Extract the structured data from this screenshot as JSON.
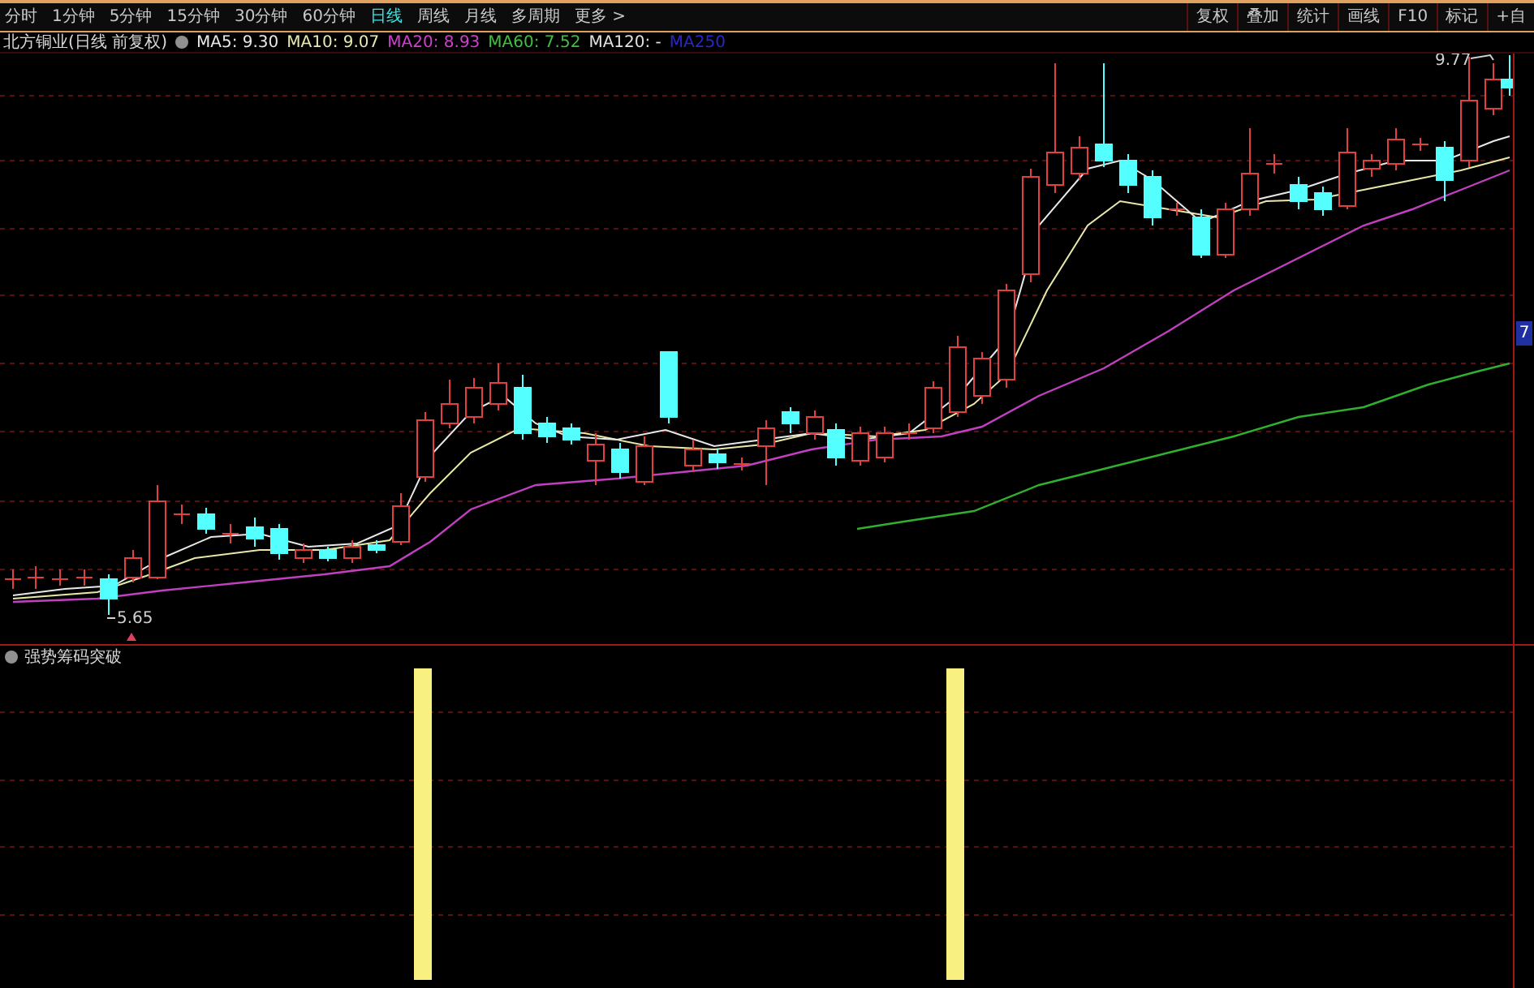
{
  "period_tabs": [
    {
      "label": "分时",
      "selected": false
    },
    {
      "label": "1分钟",
      "selected": false
    },
    {
      "label": "5分钟",
      "selected": false
    },
    {
      "label": "15分钟",
      "selected": false
    },
    {
      "label": "30分钟",
      "selected": false
    },
    {
      "label": "60分钟",
      "selected": false
    },
    {
      "label": "日线",
      "selected": true
    },
    {
      "label": "周线",
      "selected": false
    },
    {
      "label": "月线",
      "selected": false
    },
    {
      "label": "多周期",
      "selected": false
    },
    {
      "label": "更多 >",
      "selected": false
    }
  ],
  "tool_buttons": [
    "复权",
    "叠加",
    "统计",
    "画线",
    "F10",
    "标记",
    "+自"
  ],
  "main_chart": {
    "title": "北方铜业(日线 前复权)",
    "ma_legend": [
      {
        "label": "MA5: 9.30",
        "color": "#e8e8e8"
      },
      {
        "label": "MA10: 9.07",
        "color": "#e8e8b0"
      },
      {
        "label": "MA20: 8.93",
        "color": "#d040d0"
      },
      {
        "label": "MA60: 7.52",
        "color": "#40c040"
      },
      {
        "label": "MA120: -",
        "color": "#e0e0e0"
      },
      {
        "label": "MA250",
        "color": "#2828c8"
      }
    ],
    "high_label": "9.77",
    "low_label": "5.65",
    "axis_label": "7"
  },
  "indicator_panel": {
    "title": "强势筹码突破"
  }
}
